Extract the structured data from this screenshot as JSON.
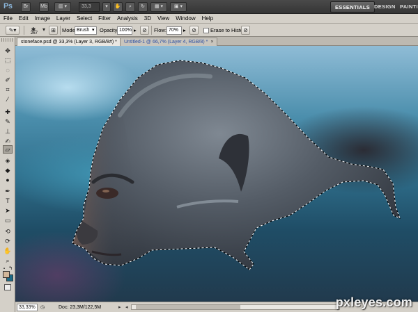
{
  "app": {
    "logo": "Ps",
    "zoom": "33,3",
    "workspaces": [
      "ESSENTIALS",
      "DESIGN",
      "PAINTI"
    ]
  },
  "menu": [
    "File",
    "Edit",
    "Image",
    "Layer",
    "Select",
    "Filter",
    "Analysis",
    "3D",
    "View",
    "Window",
    "Help"
  ],
  "options": {
    "brush_size": "267",
    "mode_label": "Mode:",
    "mode_value": "Brush",
    "opacity_label": "Opacity:",
    "opacity_value": "100%",
    "flow_label": "Flow:",
    "flow_value": "70%",
    "erase_to_history": "Erase to History"
  },
  "tabs": [
    {
      "label": "stoneface.psd @ 33,3% (Layer 3, RGB/8#) *",
      "active": true
    },
    {
      "label": "Untitled-1 @ 66,7% (Layer 4, RGB/8) *",
      "active": false
    }
  ],
  "tab_close": "×",
  "status": {
    "zoom": "33,33%",
    "doc": "Doc: 23,3M/122,5M"
  },
  "colors": {
    "foreground": "#d2b79a",
    "background": "#1d6a86"
  },
  "watermark": "pxleyes.com"
}
